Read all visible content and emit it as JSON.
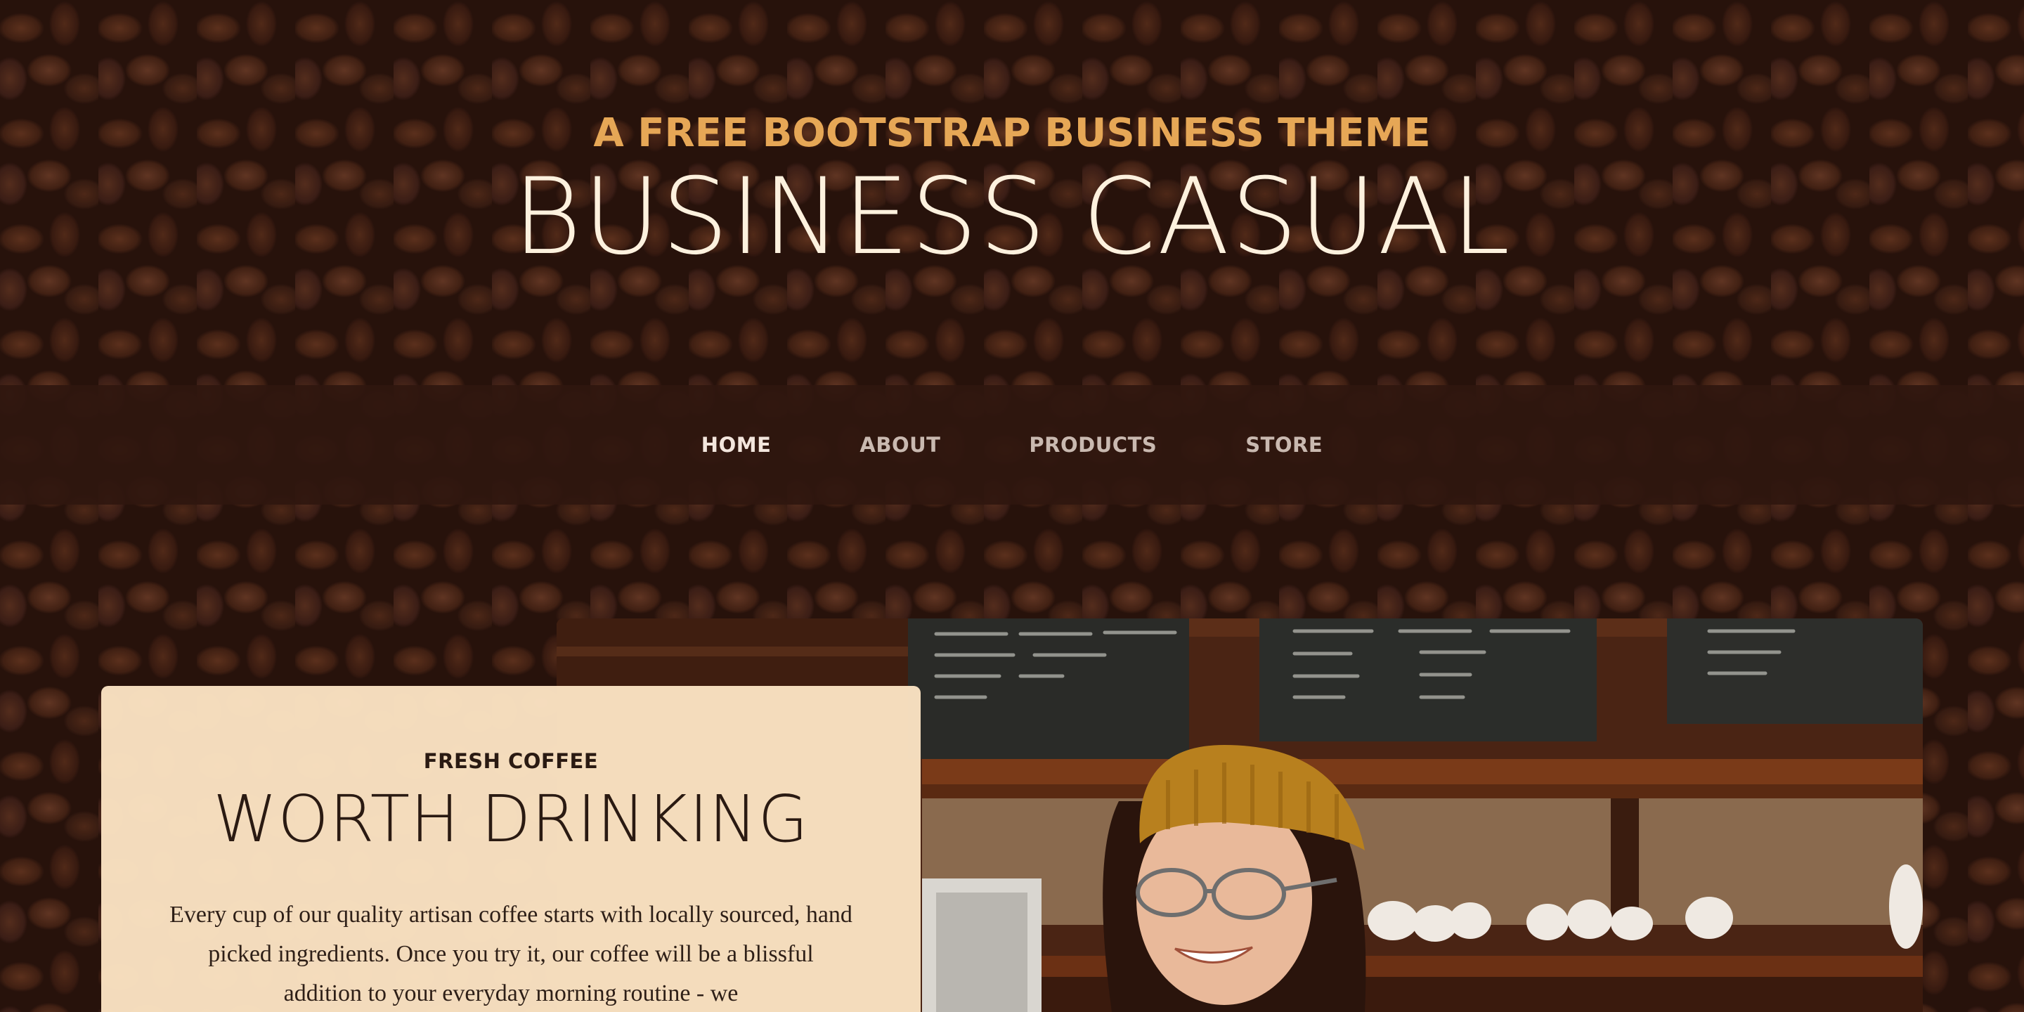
{
  "header": {
    "upper": "A FREE BOOTSTRAP BUSINESS THEME",
    "lower": "BUSINESS CASUAL"
  },
  "nav": {
    "items": [
      {
        "label": "HOME",
        "active": true
      },
      {
        "label": "ABOUT",
        "active": false
      },
      {
        "label": "PRODUCTS",
        "active": false
      },
      {
        "label": "STORE",
        "active": false
      }
    ]
  },
  "intro": {
    "upper": "FRESH COFFEE",
    "lower": "WORTH DRINKING",
    "text": "Every cup of our quality artisan coffee starts with locally sourced, hand picked ingredients. Once you try it, our coffee will be a blissful addition to your everyday morning routine - we"
  },
  "colors": {
    "accent": "#e6a756",
    "heading_light": "#fdf1de",
    "nav_bg": "#2f170f",
    "card_bg": "#fae2c2",
    "background": "#2b150d"
  },
  "background_image": "coffee-beans",
  "photo": "barista-woman-smiling-cafe"
}
